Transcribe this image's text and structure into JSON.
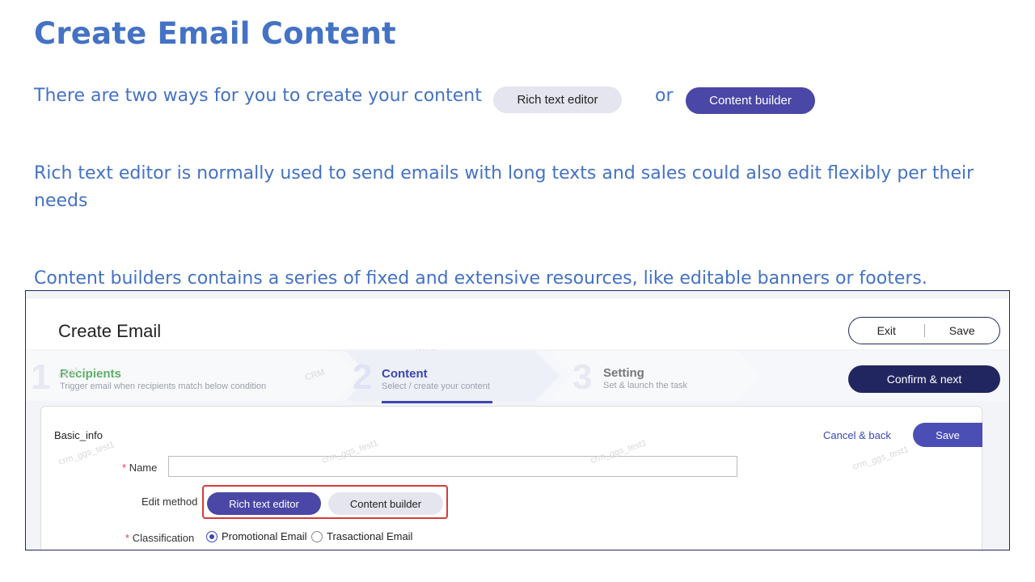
{
  "slide": {
    "title": "Create Email Content",
    "intro": "There are two ways for you to create your content",
    "or": "or",
    "pill_rich": "Rich text editor",
    "pill_builder": "Content builder",
    "rich_desc": "Rich text editor is normally used to send emails with long texts and sales could also edit flexibly per their needs",
    "builder_desc": "Content builders contains a series of fixed and extensive resources, like editable banners or footers."
  },
  "app": {
    "title": "Create Email",
    "exit_label": "Exit",
    "save_label": "Save",
    "steps": [
      {
        "num": "1",
        "title": "Recipients",
        "subtitle": "Trigger email when recipients match below condition"
      },
      {
        "num": "2",
        "title": "Content",
        "subtitle": "Select / create your content"
      },
      {
        "num": "3",
        "title": "Setting",
        "subtitle": "Set & launch the task"
      }
    ],
    "confirm_label": "Confirm & next",
    "form": {
      "section": "Basic_info",
      "cancel_back": "Cancel & back",
      "save": "Save",
      "name_label": "Name",
      "required_mark": "*",
      "name_value": "",
      "edit_method_label": "Edit method",
      "edit_methods": [
        "Rich text editor",
        "Content builder"
      ],
      "selected_method": "Rich text editor",
      "classification_label": "Classification",
      "classifications": [
        "Promotional Email",
        "Trasactional Email"
      ],
      "selected_classification": "Promotional Email"
    },
    "watermark": "crm_ggs_test1",
    "watermark_crm": "CRM"
  },
  "colors": {
    "accent": "#4472c4",
    "primary_button": "#4b47a6",
    "dark_button": "#222660",
    "highlight_border": "#d63a3a",
    "step_done": "#5cae67",
    "step_active": "#3b46b3"
  }
}
